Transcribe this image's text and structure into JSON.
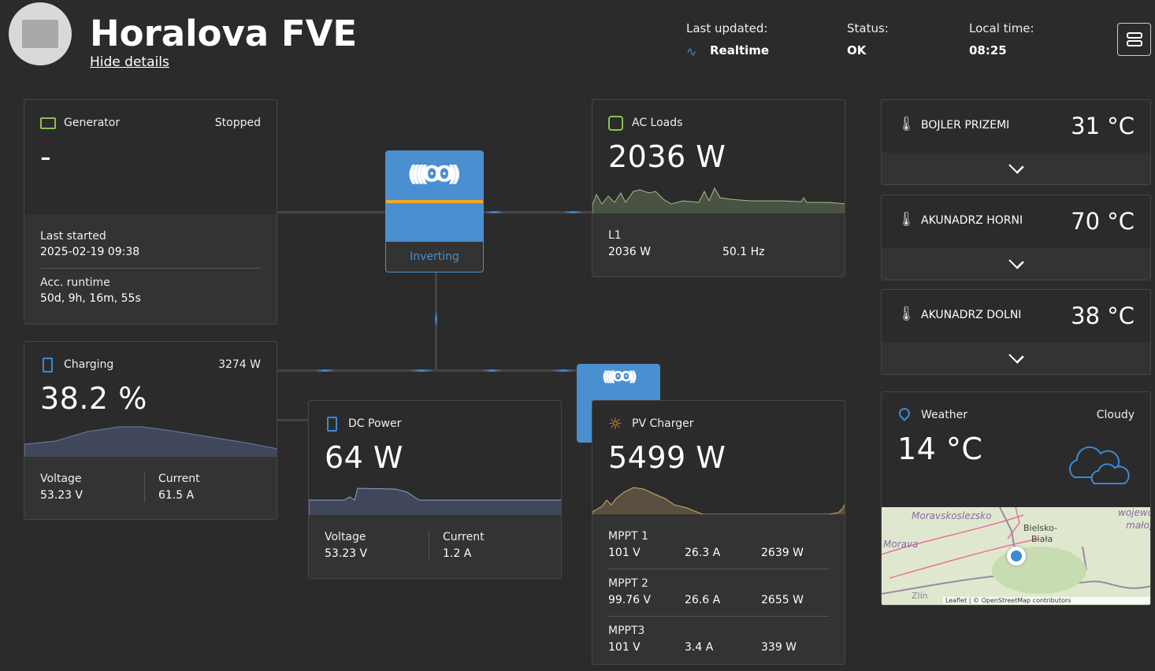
{
  "header": {
    "title": "Horalova FVE",
    "hide_details": "Hide details",
    "last_updated_label": "Last updated:",
    "last_updated_value": "Realtime",
    "status_label": "Status:",
    "status_value": "OK",
    "local_time_label": "Local time:",
    "local_time_value": "08:25"
  },
  "generator": {
    "title": "Generator",
    "state": "Stopped",
    "value": "-",
    "last_started_label": "Last started",
    "last_started_value": "2025-02-19 09:38",
    "runtime_label": "Acc. runtime",
    "runtime_value": "50d, 9h, 16m, 55s"
  },
  "battery": {
    "state": "Charging",
    "power": "3274 W",
    "soc": "38.2 %",
    "voltage_label": "Voltage",
    "voltage": "53.23 V",
    "current_label": "Current",
    "current": "61.5 A"
  },
  "inverter": {
    "state": "Inverting"
  },
  "ac_loads": {
    "title": "AC Loads",
    "value": "2036 W",
    "phase": "L1",
    "phase_power": "2036 W",
    "frequency": "50.1 Hz"
  },
  "dc_power": {
    "title": "DC Power",
    "value": "64 W",
    "voltage_label": "Voltage",
    "voltage": "53.23 V",
    "current_label": "Current",
    "current": "1.2 A"
  },
  "pv": {
    "title": "PV Charger",
    "value": "5499 W",
    "mppts": [
      {
        "name": "MPPT 1",
        "voltage": "101 V",
        "current": "26.3 A",
        "power": "2639 W"
      },
      {
        "name": "MPPT 2",
        "voltage": "99.76 V",
        "current": "26.6 A",
        "power": "2655 W"
      },
      {
        "name": "MPPT3",
        "voltage": "101 V",
        "current": "3.4 A",
        "power": "339 W"
      }
    ]
  },
  "temperatures": [
    {
      "name": "BOJLER PRIZEMI",
      "value": "31 °C"
    },
    {
      "name": "AKUNADRZ HORNI",
      "value": "70 °C"
    },
    {
      "name": "AKUNADRZ DOLNI",
      "value": "38 °C"
    }
  ],
  "weather": {
    "title": "Weather",
    "condition": "Cloudy",
    "temperature": "14 °C",
    "map_labels": [
      "Moravskoslezsko",
      "Morava",
      "Bielsko-",
      "Biała",
      "wojewó",
      "małop",
      "Zlín"
    ],
    "attribution": "Leaflet | © OpenStreetMap contributors"
  },
  "colors": {
    "accent": "#3a8ad6",
    "orange": "#f5a623",
    "ac_green": "#8bc34a",
    "bg": "#2b2b2b"
  }
}
